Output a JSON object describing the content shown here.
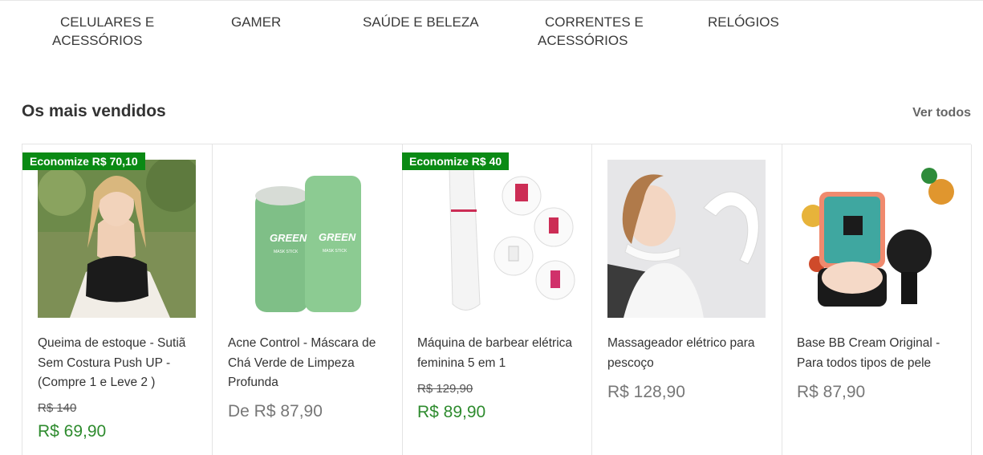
{
  "categories": [
    {
      "line1": "CELULARES E",
      "line2": "ACESSÓRIOS"
    },
    {
      "line1": "GAMER",
      "line2": ""
    },
    {
      "line1": "SAÚDE E BELEZA",
      "line2": ""
    },
    {
      "line1": "CORRENTES E",
      "line2": "ACESSÓRIOS"
    },
    {
      "line1": "RELÓGIOS",
      "line2": ""
    }
  ],
  "section": {
    "title": "Os mais vendidos",
    "see_all": "Ver todos"
  },
  "colors": {
    "badge": "#0a8a14",
    "sale_price": "#2e8b2e",
    "regular_price": "#777777"
  },
  "products": [
    {
      "badge": "Economize R$ 70,10",
      "title": "Queima de estoque - Sutiã Sem Costura Push UP - (Compre 1 e Leve 2 )",
      "old_price": "R$ 140",
      "price": "R$ 69,90",
      "image": "bra-model-photo"
    },
    {
      "badge": "",
      "title": "Acne Control - Máscara de Chá Verde de Limpeza Profunda",
      "old_price": "",
      "price": "De R$ 87,90",
      "image": "green-mask-stick-photo",
      "label": "GREEN",
      "sublabel": "MASK STICK"
    },
    {
      "badge": "Economize R$ 40",
      "title": "Máquina de barbear elétrica feminina 5 em 1",
      "old_price": "R$ 129,90",
      "price": "R$ 89,90",
      "image": "shaver-photo"
    },
    {
      "badge": "",
      "title": "Massageador elétrico para pescoço",
      "old_price": "",
      "price": "R$ 128,90",
      "image": "neck-massager-photo"
    },
    {
      "badge": "",
      "title": "Base BB Cream Original - Para todos tipos de pele",
      "old_price": "",
      "price": "R$ 87,90",
      "image": "bb-cream-photo"
    }
  ]
}
